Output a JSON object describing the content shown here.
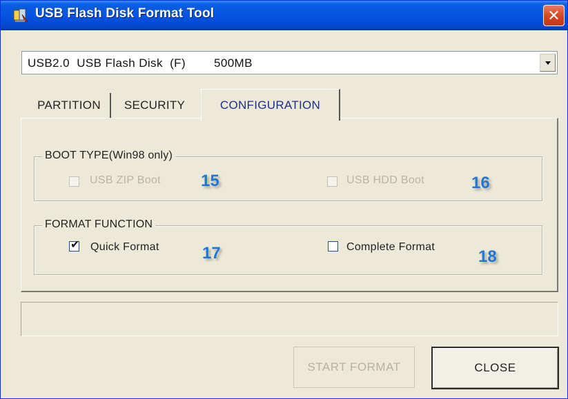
{
  "window": {
    "title": "USB Flash Disk Format Tool",
    "close_glyph": "✕"
  },
  "device": {
    "selected": "USB2.0  USB Flash Disk  (F)        500MB"
  },
  "tabs": [
    {
      "label": "PARTITION",
      "active": false
    },
    {
      "label": "SECURITY",
      "active": false
    },
    {
      "label": "CONFIGURATION",
      "active": true
    }
  ],
  "boot_type": {
    "legend": "BOOT TYPE(Win98 only)",
    "zip_boot": {
      "label": "USB ZIP Boot",
      "checked": false,
      "enabled": false
    },
    "hdd_boot": {
      "label": "USB HDD Boot",
      "checked": false,
      "enabled": false
    }
  },
  "format_function": {
    "legend": "FORMAT FUNCTION",
    "quick": {
      "label": "Quick Format",
      "checked": true,
      "enabled": true
    },
    "complete": {
      "label": "Complete Format",
      "checked": false,
      "enabled": true
    }
  },
  "callouts": {
    "n15": "15",
    "n16": "16",
    "n17": "17",
    "n18": "18"
  },
  "status": {
    "text": ""
  },
  "buttons": {
    "start": "START FORMAT",
    "close": "CLOSE"
  },
  "check_glyph": "✔",
  "colors": {
    "title_bar": "#0554e3",
    "callout": "#2178d4",
    "window_bg": "#ece9d8"
  }
}
